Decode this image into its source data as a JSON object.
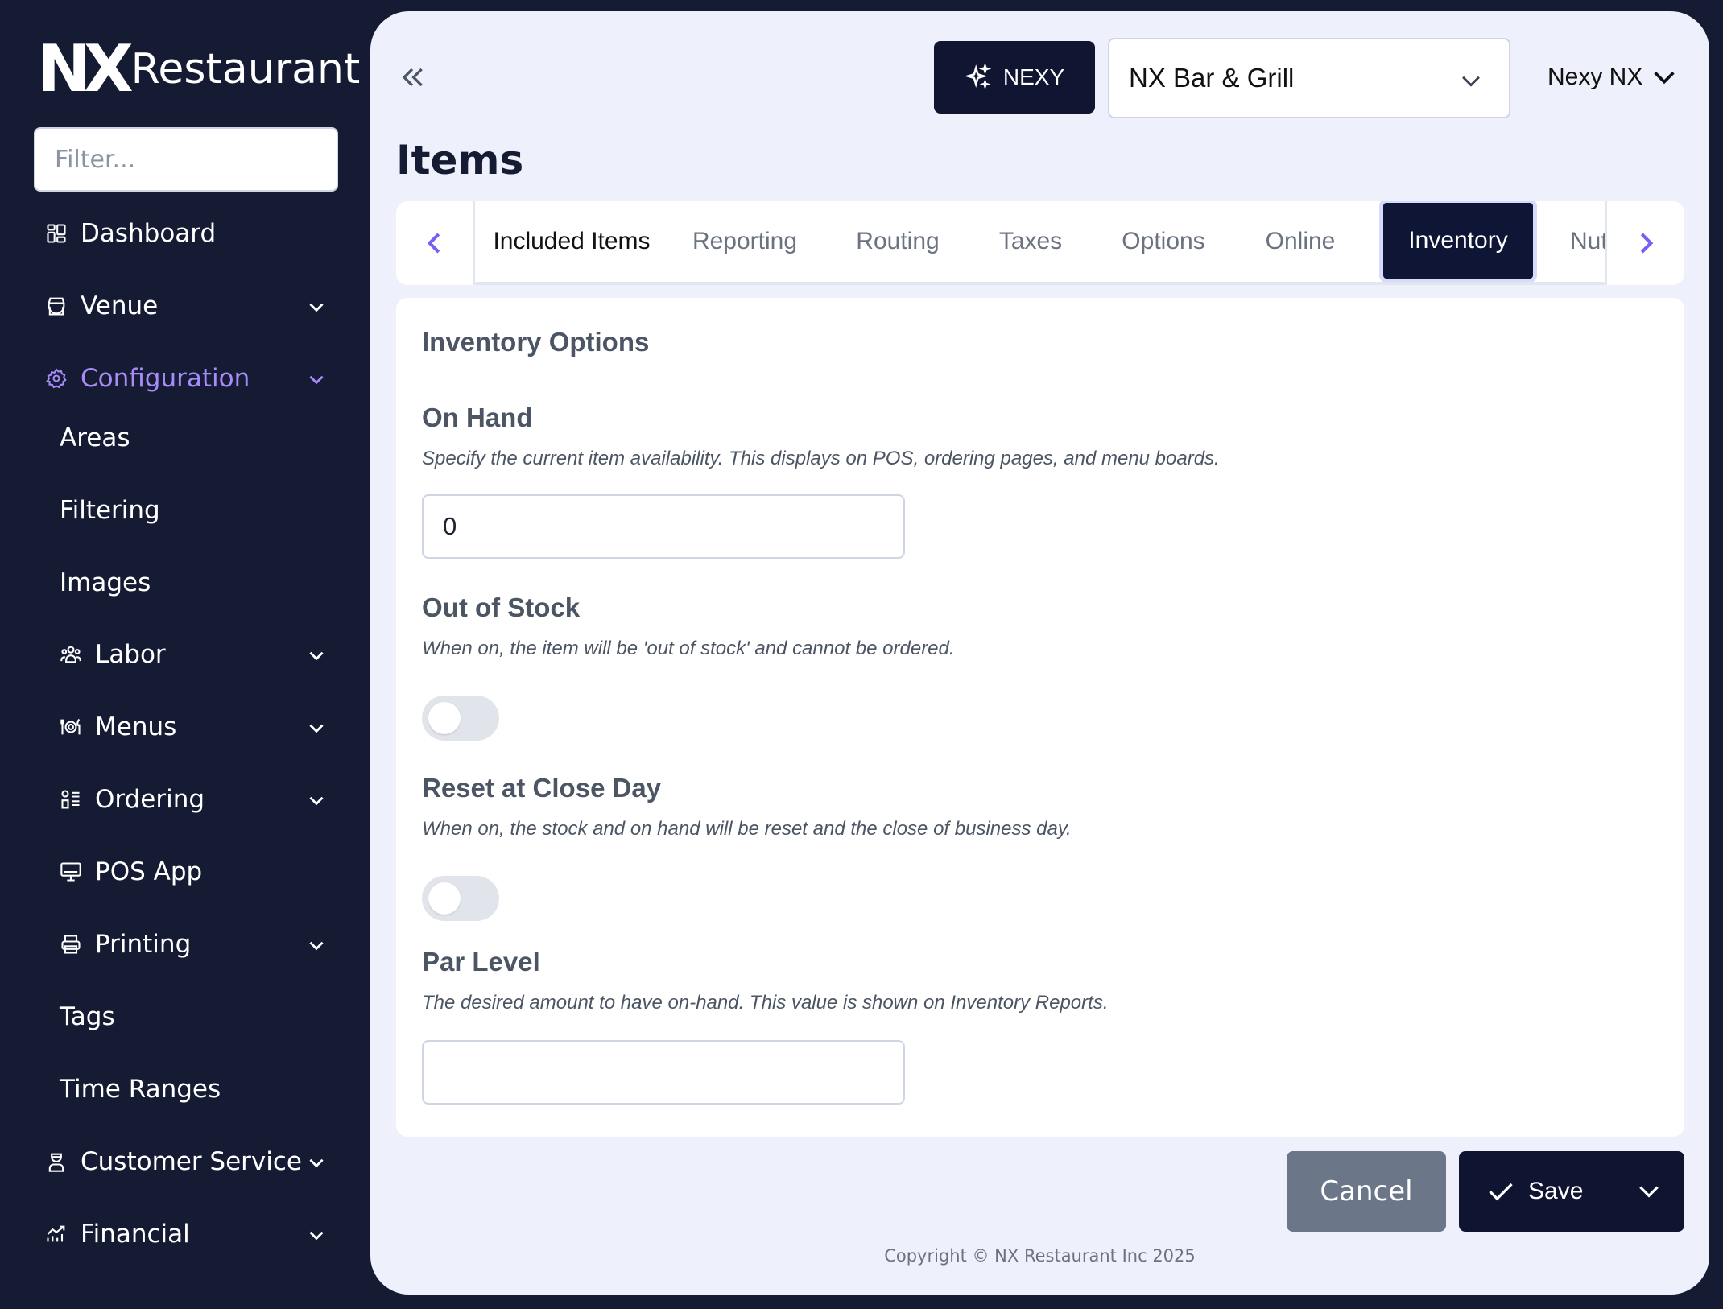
{
  "brand": {
    "mark": "NX",
    "name": "Restaurant"
  },
  "sidebar": {
    "filter_placeholder": "Filter...",
    "items": [
      {
        "label": "Dashboard",
        "icon": "dashboard-icon",
        "expandable": false
      },
      {
        "label": "Venue",
        "icon": "venue-icon",
        "expandable": true
      },
      {
        "label": "Configuration",
        "icon": "gear-icon",
        "expandable": true,
        "active": true
      },
      {
        "label": "Areas"
      },
      {
        "label": "Filtering"
      },
      {
        "label": "Images"
      },
      {
        "label": "Labor",
        "icon": "users-icon",
        "expandable": true
      },
      {
        "label": "Menus",
        "icon": "dining-icon",
        "expandable": true
      },
      {
        "label": "Ordering",
        "icon": "ordering-icon",
        "expandable": true
      },
      {
        "label": "POS App",
        "icon": "monitor-icon",
        "expandable": false
      },
      {
        "label": "Printing",
        "icon": "printer-icon",
        "expandable": true
      },
      {
        "label": "Tags"
      },
      {
        "label": "Time Ranges"
      },
      {
        "label": "Customer Service",
        "icon": "customer-service-icon",
        "expandable": true
      },
      {
        "label": "Financial",
        "icon": "financial-icon",
        "expandable": true
      }
    ]
  },
  "header": {
    "nexy_label": "NEXY",
    "venue": "NX Bar & Grill",
    "user": "Nexy NX"
  },
  "page_title": "Items",
  "tabs": [
    "Included Items",
    "Reporting",
    "Routing",
    "Taxes",
    "Options",
    "Online",
    "Inventory",
    "Nutrition"
  ],
  "active_tab": "Inventory",
  "inventory": {
    "section_title": "Inventory Options",
    "on_hand": {
      "label": "On Hand",
      "help": "Specify the current item availability. This displays on POS, ordering pages, and menu boards.",
      "value": "0"
    },
    "out_of_stock": {
      "label": "Out of Stock",
      "help": "When on, the item will be 'out of stock' and cannot be ordered.",
      "enabled": false
    },
    "reset_at_close": {
      "label": "Reset at Close Day",
      "help": "When on, the stock and on hand will be reset and the close of business day.",
      "enabled": false
    },
    "par_level": {
      "label": "Par Level",
      "help": "The desired amount to have on-hand. This value is shown on Inventory Reports.",
      "value": ""
    }
  },
  "footer": {
    "cancel_label": "Cancel",
    "save_label": "Save",
    "copyright": "Copyright © NX Restaurant Inc 2025"
  },
  "colors": {
    "sidebar_bg": "#141b33",
    "main_bg": "#eef1fb",
    "accent": "#a78bfa",
    "tab_arrow": "#7c5cf5",
    "dark_button": "#0f1531",
    "cancel_button": "#6b7689"
  }
}
